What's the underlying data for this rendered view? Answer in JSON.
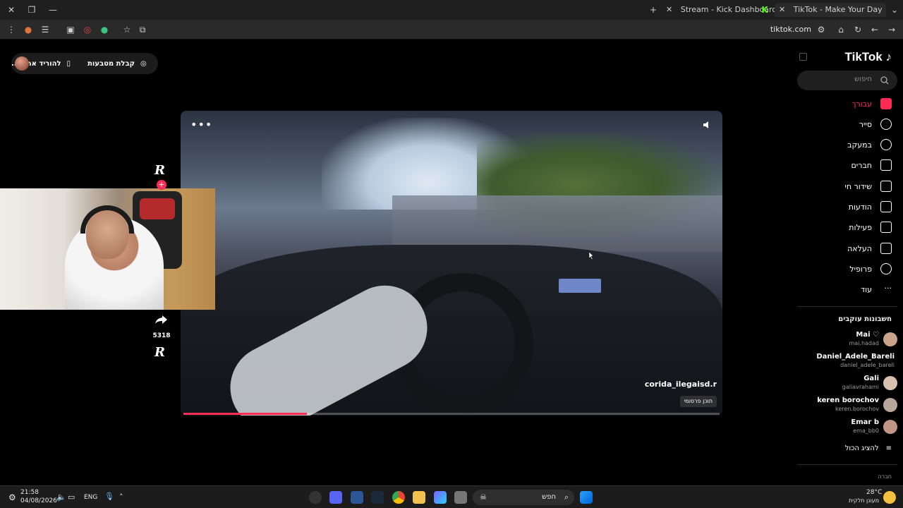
{
  "browser": {
    "tabs": [
      {
        "label": "Stream - Kick Dashboard"
      },
      {
        "label": "TikTok - Make Your Day"
      }
    ],
    "address": "tiktok.com"
  },
  "top_pill": {
    "download_label": "להוריד את ה...",
    "coins_label": "קבלת מטבעות"
  },
  "video": {
    "username": "corida_ilegaisd.r",
    "badge": "תוכן פרסומי",
    "progress_fraction": 0.23
  },
  "actions": {
    "share_count": "5318",
    "logo_letter": "R"
  },
  "sidebar": {
    "logo": "TikTok",
    "search_placeholder": "חיפוש",
    "nav": [
      {
        "label": "עבורך",
        "icon": "home-icon",
        "active": true
      },
      {
        "label": "סייר",
        "icon": "compass-icon"
      },
      {
        "label": "במעקב",
        "icon": "following-avatar-icon"
      },
      {
        "label": "חברים",
        "icon": "friends-icon"
      },
      {
        "label": "שידור חי",
        "icon": "live-tv-icon"
      },
      {
        "label": "הודעות",
        "icon": "send-icon"
      },
      {
        "label": "פעילות",
        "icon": "activity-icon"
      },
      {
        "label": "העלאה",
        "icon": "upload-icon"
      },
      {
        "label": "פרופיל",
        "icon": "profile-avatar-icon"
      },
      {
        "label": "עוד",
        "icon": "more-icon"
      }
    ],
    "following_title": "חשבונות עוקבים",
    "following": [
      {
        "name": "Mai ♡",
        "handle": "mai.hadad",
        "color": "#c9a38a"
      },
      {
        "name": "Daniel_Adele_Bareli",
        "handle": "daniel_adele_bareli",
        "color": ""
      },
      {
        "name": "Gali",
        "handle": "galiavrahami",
        "color": "#d8c1b0"
      },
      {
        "name": "keren borochov",
        "handle": "keren.borochov",
        "color": "#b8a69a"
      },
      {
        "name": "Emar b",
        "handle": "ema_bb0",
        "color": "#c29686"
      }
    ],
    "show_all": "להציג הכול",
    "company": "חברה"
  },
  "taskbar": {
    "time": "21:58",
    "date": "04/08/2026",
    "lang": "ENG",
    "search_placeholder": "חפש",
    "weather_temp": "28°C",
    "weather_desc": "מעונן חלקית",
    "colors": {
      "accent": "#fe2c55"
    }
  }
}
